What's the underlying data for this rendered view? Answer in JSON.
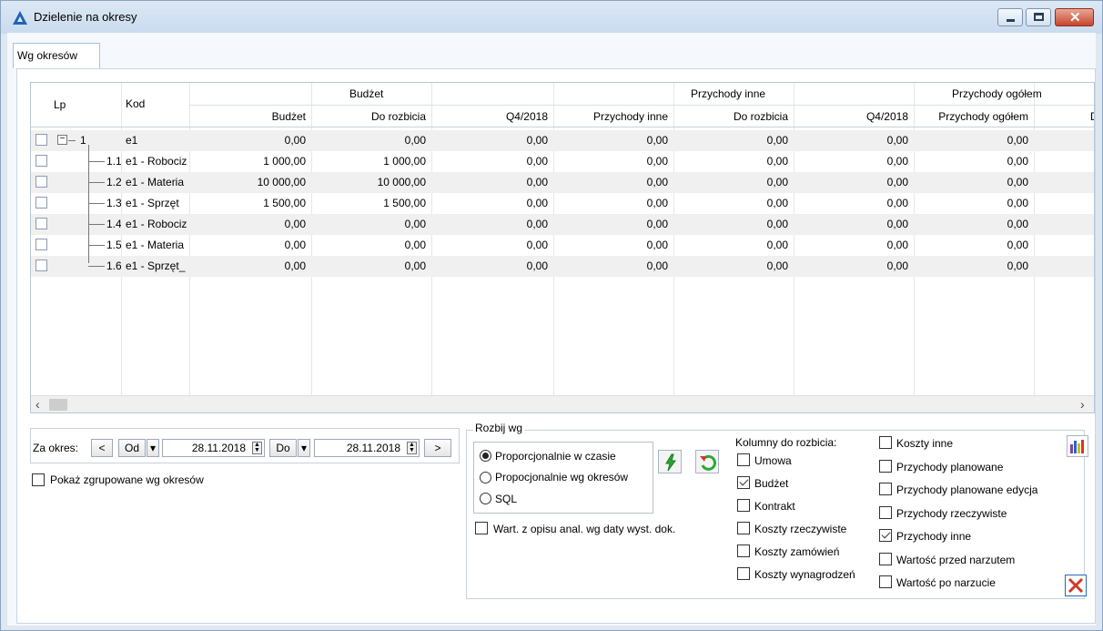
{
  "window": {
    "title": "Dzielenie na okresy",
    "controls": {
      "minimize": "minimize",
      "maximize": "maximize",
      "close": "✕"
    }
  },
  "tabs": [
    {
      "label": "Wg okresów",
      "active": true
    }
  ],
  "grid": {
    "headers": {
      "lp": "Lp",
      "kod": "Kod",
      "group_budzet": "Budżet",
      "group_przychody_inne": "Przychody inne",
      "group_przychody_ogolem": "Przychody ogółem",
      "col_budzet": "Budżet",
      "col_do_rozbicia_1": "Do rozbicia",
      "col_q4_1": "Q4/2018",
      "col_przychody_inne": "Przychody inne",
      "col_do_rozbicia_2": "Do rozbicia",
      "col_q4_2": "Q4/2018",
      "col_przychody_ogolem": "Przychody ogółem",
      "col_partial": "D"
    },
    "rows": [
      {
        "lp": "1",
        "kod": "e1",
        "budzet": "0,00",
        "do_rozbicia": "0,00",
        "q4": "0,00",
        "przych_inne": "0,00",
        "do_rozbicia2": "0,00",
        "q4_2": "0,00",
        "przych_ogolem": "0,00"
      },
      {
        "lp": "1.1",
        "kod": "e1 - Robociz",
        "budzet": "1 000,00",
        "do_rozbicia": "1 000,00",
        "q4": "0,00",
        "przych_inne": "0,00",
        "do_rozbicia2": "0,00",
        "q4_2": "0,00",
        "przych_ogolem": "0,00"
      },
      {
        "lp": "1.2",
        "kod": "e1 - Materia",
        "budzet": "10 000,00",
        "do_rozbicia": "10 000,00",
        "q4": "0,00",
        "przych_inne": "0,00",
        "do_rozbicia2": "0,00",
        "q4_2": "0,00",
        "przych_ogolem": "0,00"
      },
      {
        "lp": "1.3",
        "kod": "e1 - Sprzęt",
        "budzet": "1 500,00",
        "do_rozbicia": "1 500,00",
        "q4": "0,00",
        "przych_inne": "0,00",
        "do_rozbicia2": "0,00",
        "q4_2": "0,00",
        "przych_ogolem": "0,00"
      },
      {
        "lp": "1.4",
        "kod": "e1 - Robociz",
        "budzet": "0,00",
        "do_rozbicia": "0,00",
        "q4": "0,00",
        "przych_inne": "0,00",
        "do_rozbicia2": "0,00",
        "q4_2": "0,00",
        "przych_ogolem": "0,00"
      },
      {
        "lp": "1.5",
        "kod": "e1 - Materia",
        "budzet": "0,00",
        "do_rozbicia": "0,00",
        "q4": "0,00",
        "przych_inne": "0,00",
        "do_rozbicia2": "0,00",
        "q4_2": "0,00",
        "przych_ogolem": "0,00"
      },
      {
        "lp": "1.6",
        "kod": "e1 - Sprzęt_",
        "budzet": "0,00",
        "do_rozbicia": "0,00",
        "q4": "0,00",
        "przych_inne": "0,00",
        "do_rozbicia2": "0,00",
        "q4_2": "0,00",
        "przych_ogolem": "0,00"
      }
    ],
    "scroll": {
      "left": "‹",
      "right": "›"
    }
  },
  "period": {
    "label": "Za okres:",
    "prev": "<",
    "from_label": "Od",
    "from_date": "28.11.2018",
    "to_label": "Do",
    "to_date": "28.11.2018",
    "next": ">",
    "dropdown": "▾"
  },
  "show_grouped": {
    "label": "Pokaż zgrupowane wg okresów",
    "checked": false
  },
  "split": {
    "legend": "Rozbij wg",
    "options": [
      {
        "label": "Proporcjonalnie w czasie",
        "selected": true
      },
      {
        "label": "Propocjonalnie wg okresów",
        "selected": false
      },
      {
        "label": "SQL",
        "selected": false
      }
    ],
    "from_description": {
      "label": "Wart. z opisu anal. wg daty wyst. dok.",
      "checked": false
    }
  },
  "columns": {
    "title": "Kolumny do rozbicia:",
    "left": [
      {
        "label": "Umowa",
        "checked": false
      },
      {
        "label": "Budżet",
        "checked": true
      },
      {
        "label": "Kontrakt",
        "checked": false
      },
      {
        "label": "Koszty rzeczywiste",
        "checked": false
      },
      {
        "label": "Koszty zamówień",
        "checked": false
      },
      {
        "label": "Koszty wynagrodzeń",
        "checked": false
      }
    ],
    "right": [
      {
        "label": "Koszty inne",
        "checked": false
      },
      {
        "label": "Przychody planowane",
        "checked": false
      },
      {
        "label": "Przychody planowane edycja",
        "checked": false
      },
      {
        "label": "Przychody rzeczywiste",
        "checked": false
      },
      {
        "label": "Przychody inne",
        "checked": true
      },
      {
        "label": "Wartość przed narzutem",
        "checked": false
      },
      {
        "label": "Wartość po narzucie",
        "checked": false
      }
    ]
  },
  "colors": {
    "accent": "#1e63b8",
    "close_red": "#d0392a",
    "green_icon": "#2aa834"
  }
}
